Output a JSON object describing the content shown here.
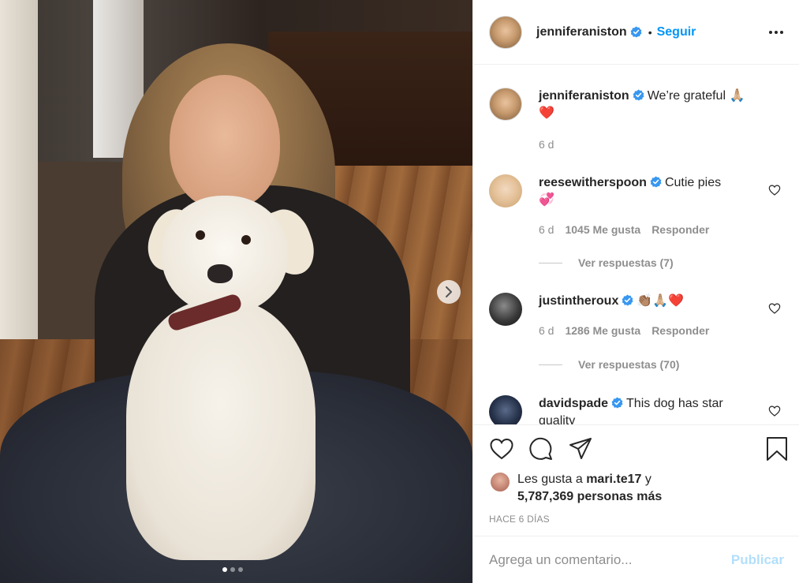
{
  "post": {
    "carousel": {
      "dots": 3,
      "active_dot": 0
    }
  },
  "header": {
    "username": "jenniferaniston",
    "separator": "•",
    "follow_label": "Seguir"
  },
  "caption": {
    "username": "jenniferaniston",
    "text": "We’re grateful 🙏🏼",
    "text2": "❤️",
    "time": "6 d"
  },
  "comments": [
    {
      "username": "reesewitherspoon",
      "text": "Cutie pies",
      "text2": "💞",
      "time": "6 d",
      "likes": "1045 Me gusta",
      "reply_label": "Responder",
      "view_replies": "Ver respuestas (7)"
    },
    {
      "username": "justintheroux",
      "text": "👏🏽🙏🏼❤️",
      "time": "6 d",
      "likes": "1286 Me gusta",
      "reply_label": "Responder",
      "view_replies": "Ver respuestas (70)"
    },
    {
      "username": "davidspade",
      "text": "This dog has star",
      "text2": "quality"
    }
  ],
  "likes": {
    "prefix": "Les gusta a",
    "user": "mari.te17",
    "suffix": "y",
    "others": "5,787,369 personas más"
  },
  "timestamp": "HACE 6 DÍAS",
  "comment_box": {
    "placeholder": "Agrega un comentario...",
    "publish_label": "Publicar"
  },
  "colors": {
    "accent": "#0095f6",
    "publish_disabled": "#b2dffc",
    "verified": "#3897f0",
    "muted": "#8e8e8e",
    "text": "#262626"
  },
  "icons": [
    "chevron-right-icon",
    "more-icon",
    "verified-icon",
    "heart-icon",
    "comment-icon",
    "share-icon",
    "bookmark-icon"
  ]
}
